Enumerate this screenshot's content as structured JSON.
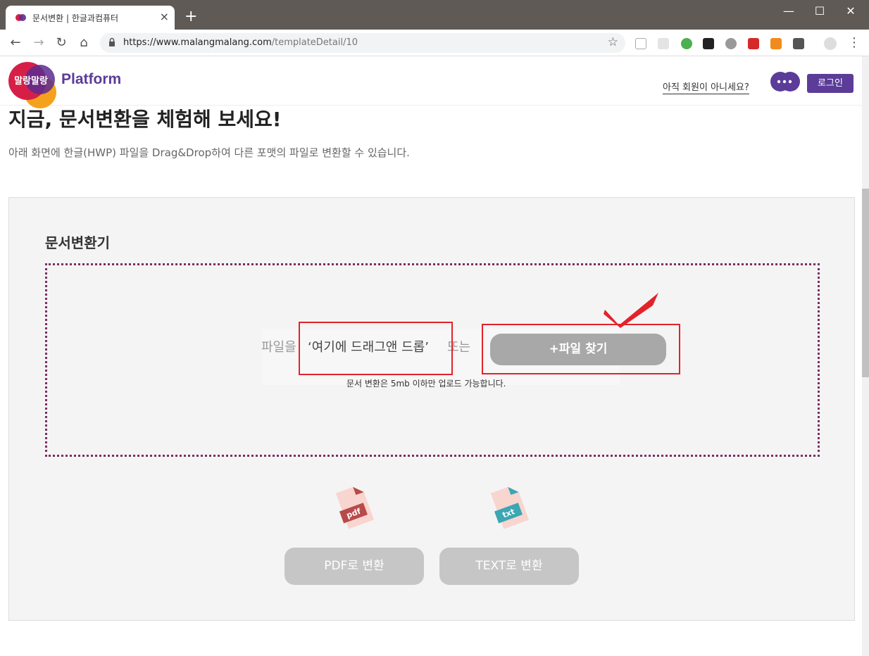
{
  "browser": {
    "tab_title": "문서변환 | 한글과컴퓨터",
    "tab_close": "×",
    "new_tab": "+",
    "window_controls": {
      "minimize": "—",
      "maximize": "☐",
      "close": "✕"
    },
    "url_host": "https://www.malangmalang.com",
    "url_path": "/templateDetail/10",
    "nav": {
      "back": "←",
      "forward": "→",
      "reload": "↻",
      "home": "⌂"
    },
    "star": "☆",
    "menu": "⋮"
  },
  "header": {
    "logo_text": "말랑말랑",
    "platform": "Platform",
    "signup_link": "아직 회원이 아니세요?",
    "login": "로그인"
  },
  "page": {
    "title": "지금, 문서변환을 체험해 보세요!",
    "description": "아래 화면에 한글(HWP) 파일을 Drag&Drop하여 다른 포맷의 파일로 변환할 수 있습니다."
  },
  "converter": {
    "title": "문서변환기",
    "drop_prefix": "파일을 ",
    "drop_quote": "‘여기에 드래그앤 드롭’",
    "drop_suffix": " 또는",
    "find_button": "+파일 찾기",
    "size_note": "문서 변환은 5mb 이하만 업로드 가능합니다.",
    "pdf_icon_label": "pdf",
    "txt_icon_label": "txt",
    "pdf_button": "PDF로 변환",
    "text_button": "TEXT로 변환"
  },
  "colors": {
    "brand_purple": "#5b3c99",
    "annotation_red": "#e3222a",
    "dropzone_border": "#7a2e66"
  }
}
